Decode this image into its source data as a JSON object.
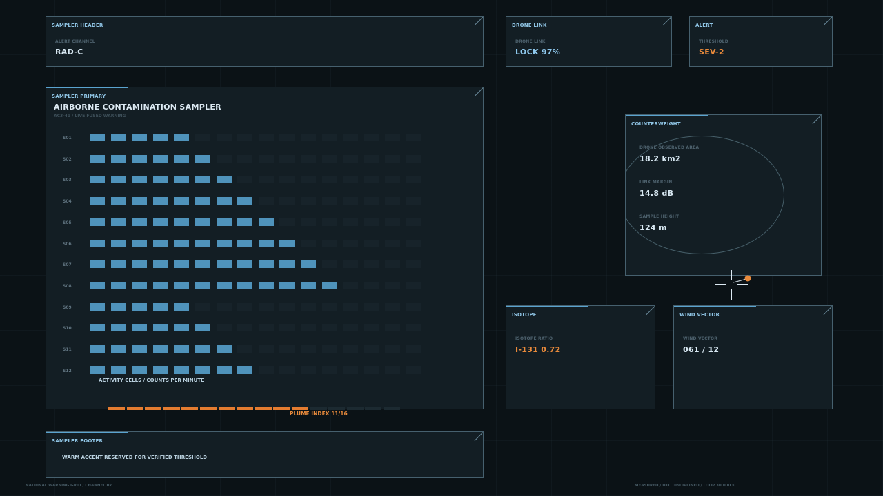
{
  "header_panel": {
    "title": "SAMPLER HEADER",
    "field_label": "ALERT CHANNEL",
    "field_value": "RAD-C"
  },
  "drone_link_panel": {
    "title": "DRONE LINK",
    "field_label": "DRONE LINK",
    "field_value": "LOCK 97%"
  },
  "alert_panel": {
    "title": "ALERT",
    "field_label": "THRESHOLD",
    "field_value": "SEV-2"
  },
  "primary_panel": {
    "title": "SAMPLER PRIMARY",
    "heading": "AIRBORNE CONTAMINATION SAMPLER",
    "subtitle": "AC3-41 / LIVE FUSED WARNING",
    "axis_caption": "ACTIVITY CELLS / COUNTS PER MINUTE",
    "plume_label": "PLUME INDEX 11/16"
  },
  "chart_data": {
    "type": "heatmap",
    "rows": [
      "S01",
      "S02",
      "S03",
      "S04",
      "S05",
      "S06",
      "S07",
      "S08",
      "S09",
      "S10",
      "S11",
      "S12"
    ],
    "cells_per_row": 16,
    "active_cells": [
      5,
      6,
      7,
      8,
      9,
      10,
      11,
      12,
      5,
      6,
      7,
      8
    ],
    "plume_index": {
      "value": 11,
      "max": 16
    },
    "on_color": "#4f93bb",
    "off_color": "#17232a",
    "plume_color": "#e47c30"
  },
  "counterweight_panel": {
    "title": "COUNTERWEIGHT",
    "fields": [
      {
        "label": "DRONE OBSERVED AREA",
        "value": "18.2 km2"
      },
      {
        "label": "LINK MARGIN",
        "value": "14.8 dB"
      },
      {
        "label": "SAMPLE HEIGHT",
        "value": "124 m"
      }
    ]
  },
  "isotope_panel": {
    "title": "ISOTOPE",
    "field_label": "ISOTOPE RATIO",
    "field_value": "I-131 0.72"
  },
  "wind_panel": {
    "title": "WIND VECTOR",
    "field_label": "WIND VECTOR",
    "field_value": "061 / 12"
  },
  "footer_panel": {
    "title": "SAMPLER FOOTER",
    "note": "WARM ACCENT RESERVED FOR VERIFIED THRESHOLD"
  },
  "footnotes": {
    "left": "NATIONAL WARNING GRID / CHANNEL 07",
    "right": "MEASURED / UTC DISCIPLINED / LOOP 30.000 s"
  },
  "colors": {
    "accent_blue": "#5aa3cf",
    "accent_orange": "#e98a3b",
    "panel_bg": "#131e24",
    "panel_border": "#46606e"
  },
  "icons": {
    "crosshair": "crosshair-icon",
    "target_dot": "target-dot-icon"
  }
}
